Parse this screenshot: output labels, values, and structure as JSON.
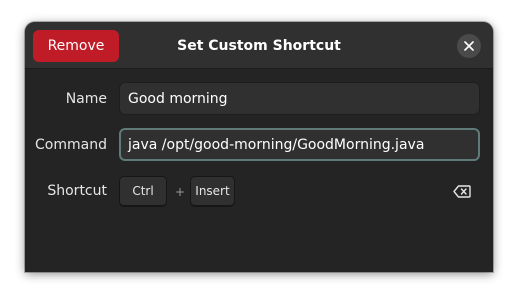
{
  "dialog": {
    "title": "Set Custom Shortcut",
    "remove_label": "Remove",
    "close_icon": "close-icon"
  },
  "form": {
    "name_label": "Name",
    "name_value": "Good morning",
    "command_label": "Command",
    "command_value": "java /opt/good-morning/GoodMorning.java",
    "shortcut_label": "Shortcut",
    "shortcut_keys": [
      "Ctrl",
      "Insert"
    ],
    "key_separator": "+",
    "clear_icon": "backspace-icon"
  },
  "colors": {
    "destructive": "#c01c28",
    "dialog_bg": "#242424",
    "headerbar_bg": "#303030",
    "focus_ring": "#5f7a78"
  }
}
